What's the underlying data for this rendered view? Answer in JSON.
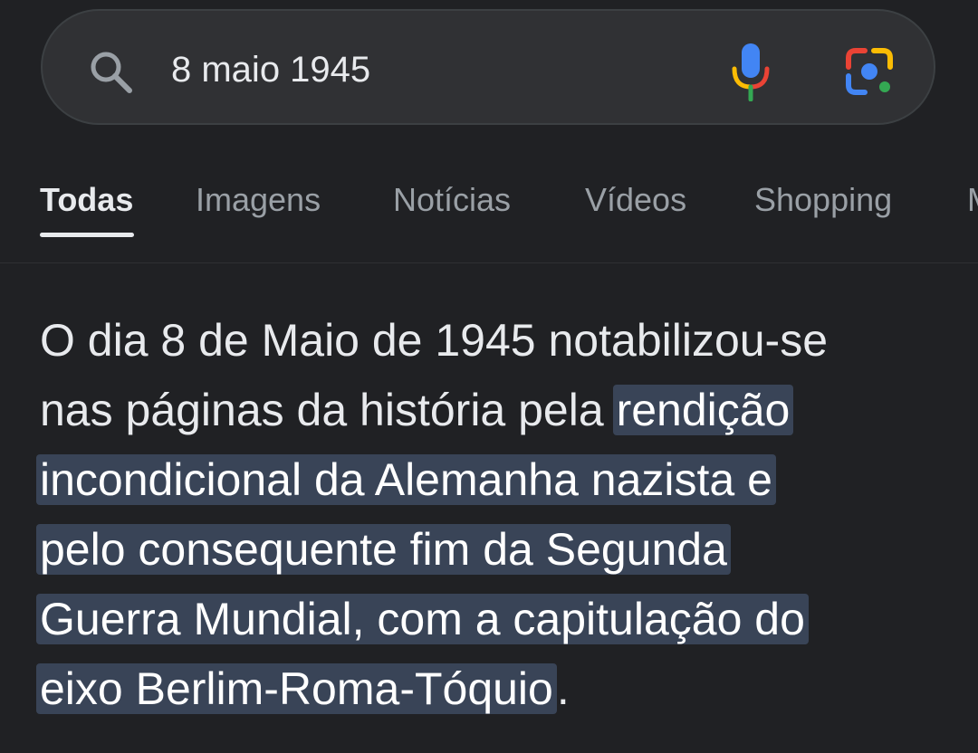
{
  "search": {
    "query": "8 maio 1945"
  },
  "icons": {
    "search": "search-icon",
    "mic": "microphone-icon",
    "lens": "google-lens-icon"
  },
  "tabs": [
    {
      "label": "Todas",
      "active": true
    },
    {
      "label": "Imagens",
      "active": false
    },
    {
      "label": "Notícias",
      "active": false
    },
    {
      "label": "Vídeos",
      "active": false
    },
    {
      "label": "Shopping",
      "active": false
    },
    {
      "label": "M",
      "active": false
    }
  ],
  "snippet": {
    "line1": "O dia 8 de Maio de 1945 notabilizou-se",
    "plain_before": "nas páginas da história pela",
    "highlight_l1": "rendição",
    "highlight_l2": "incondicional da Alemanha nazista e",
    "highlight_l3": "pelo consequente fim da Segunda",
    "highlight_l4": "Guerra Mundial, com a capitulação do",
    "highlight_l5": "eixo Berlim-Roma-Tóquio",
    "trailing": "."
  },
  "colors": {
    "background": "#202124",
    "searchbar": "#303134",
    "highlight": "#394457",
    "tab_inactive": "#9aa0a6",
    "text": "#e8eaed"
  }
}
